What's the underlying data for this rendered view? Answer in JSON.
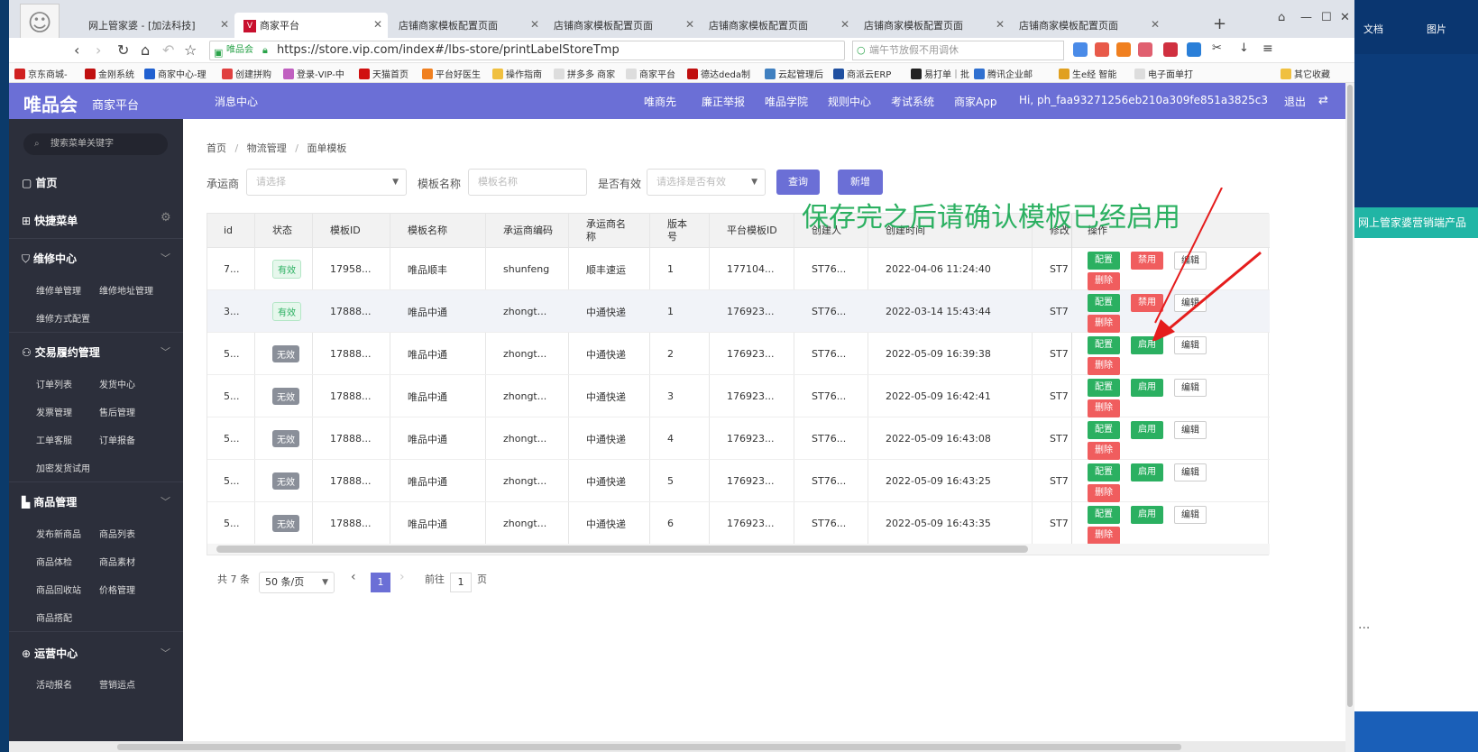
{
  "right_panel": {
    "doc_label": "文档",
    "pic_label": "图片",
    "ad_text": "网上管家婆营销端产品",
    "more": "..."
  },
  "tabs": [
    {
      "label": "网上管家婆 - [加法科技]"
    },
    {
      "label": "商家平台"
    },
    {
      "label": "店铺商家模板配置页面"
    },
    {
      "label": "店铺商家模板配置页面"
    },
    {
      "label": "店铺商家模板配置页面"
    },
    {
      "label": "店铺商家模板配置页面"
    },
    {
      "label": "店铺商家模板配置页面"
    }
  ],
  "address": {
    "site_tag": "唯品会",
    "https": "https://",
    "url": "https://store.vip.com/index#/lbs-store/printLabelStoreTmp",
    "search_placeholder": "端午节放假不用调休"
  },
  "bookmarks": [
    "京东商城-",
    "金刚系统",
    "商家中心-理",
    "创建拼购",
    "登录-VIP-中",
    "天猫首页",
    "平台好医生",
    "操作指南",
    "拼多多 商家",
    "商家平台",
    "德达deda制",
    "云起管理后",
    "商派云ERP",
    "易打单｜批",
    "腾讯企业邮",
    "生e经 智能",
    "电子面单打",
    "其它收藏"
  ],
  "header": {
    "logo": "唯品会",
    "logo_sub": "商家平台",
    "msg_center": "消息中心",
    "nav": [
      "唯商先",
      "廉正举报",
      "唯品学院",
      "规则中心",
      "考试系统",
      "商家App"
    ],
    "user": "Hi, ph_faa93271256eb210a309fe851a3825c3",
    "logout": "退出"
  },
  "sidebar": {
    "search": "搜索菜单关键字",
    "home": "首页",
    "quick": "快捷菜单",
    "sections": [
      {
        "title": "维修中心",
        "items": [
          "维修单管理",
          "维修地址管理",
          "维修方式配置"
        ]
      },
      {
        "title": "交易履约管理",
        "items": [
          "订单列表",
          "发货中心",
          "发票管理",
          "售后管理",
          "工单客服",
          "订单报备",
          "加密发货试用"
        ]
      },
      {
        "title": "商品管理",
        "items": [
          "发布新商品",
          "商品列表",
          "商品体检",
          "商品素材",
          "商品回收站",
          "价格管理",
          "商品搭配"
        ]
      },
      {
        "title": "运营中心",
        "items": [
          "活动报名",
          "营销运点"
        ]
      }
    ]
  },
  "main": {
    "breadcrumb": [
      "首页",
      "物流管理",
      "面单模板"
    ],
    "filters": {
      "carrier_label": "承运商",
      "carrier_placeholder": "请选择",
      "name_label": "模板名称",
      "name_placeholder": "模板名称",
      "valid_label": "是否有效",
      "valid_placeholder": "请选择是否有效",
      "query": "查询",
      "add": "新增"
    },
    "overlay_text": "保存完之后请确认模板已经启用",
    "columns": [
      "id",
      "状态",
      "模板ID",
      "模板名称",
      "承运商编码",
      "承运商名称",
      "版本号",
      "平台模板ID",
      "创建人",
      "创建时间",
      "修改",
      "操作"
    ],
    "rows": [
      {
        "id": "7...",
        "status": "有效",
        "tid": "17958...",
        "name": "唯品顺丰",
        "code": "shunfeng",
        "carrier": "顺丰速运",
        "ver": "1",
        "ptid": "177104...",
        "creator": "ST76...",
        "time": "2022-04-06 11:24:40",
        "mod": "ST7",
        "valid": true
      },
      {
        "id": "3...",
        "status": "有效",
        "tid": "17888...",
        "name": "唯品中通",
        "code": "zhongt...",
        "carrier": "中通快递",
        "ver": "1",
        "ptid": "176923...",
        "creator": "ST76...",
        "time": "2022-03-14 15:43:44",
        "mod": "ST7",
        "valid": true
      },
      {
        "id": "5...",
        "status": "无效",
        "tid": "17888...",
        "name": "唯品中通",
        "code": "zhongt...",
        "carrier": "中通快递",
        "ver": "2",
        "ptid": "176923...",
        "creator": "ST76...",
        "time": "2022-05-09 16:39:38",
        "mod": "ST7",
        "valid": false
      },
      {
        "id": "5...",
        "status": "无效",
        "tid": "17888...",
        "name": "唯品中通",
        "code": "zhongt...",
        "carrier": "中通快递",
        "ver": "3",
        "ptid": "176923...",
        "creator": "ST76...",
        "time": "2022-05-09 16:42:41",
        "mod": "ST7",
        "valid": false
      },
      {
        "id": "5...",
        "status": "无效",
        "tid": "17888...",
        "name": "唯品中通",
        "code": "zhongt...",
        "carrier": "中通快递",
        "ver": "4",
        "ptid": "176923...",
        "creator": "ST76...",
        "time": "2022-05-09 16:43:08",
        "mod": "ST7",
        "valid": false
      },
      {
        "id": "5...",
        "status": "无效",
        "tid": "17888...",
        "name": "唯品中通",
        "code": "zhongt...",
        "carrier": "中通快递",
        "ver": "5",
        "ptid": "176923...",
        "creator": "ST76...",
        "time": "2022-05-09 16:43:25",
        "mod": "ST7",
        "valid": false
      },
      {
        "id": "5...",
        "status": "无效",
        "tid": "17888...",
        "name": "唯品中通",
        "code": "zhongt...",
        "carrier": "中通快递",
        "ver": "6",
        "ptid": "176923...",
        "creator": "ST76...",
        "time": "2022-05-09 16:43:35",
        "mod": "ST7",
        "valid": false
      }
    ],
    "actions": {
      "config": "配置",
      "delete": "删除",
      "disable": "禁用",
      "enable": "启用",
      "edit": "编辑"
    },
    "pager": {
      "total": "共 7 条",
      "per_page": "50 条/页",
      "current": "1",
      "goto": "前往",
      "goto_value": "1",
      "page_unit": "页"
    }
  },
  "colors": {
    "brand": "#6b6fd6",
    "sidebar": "#2c2f3b",
    "green": "#2bb061",
    "red": "#f05d5e"
  }
}
